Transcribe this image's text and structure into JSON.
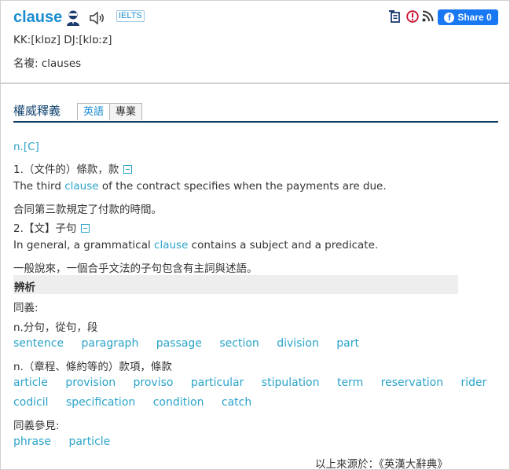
{
  "header": {
    "word": "clause",
    "badge": "IELTS",
    "share_label": "Share 0",
    "pronunciation": "KK:[klɒz] DJ:[klɒːz]",
    "plural": "名複: clauses",
    "icons": [
      "speaker-person-icon",
      "audio-icon",
      "add-to-wordlist-icon",
      "report-error-icon",
      "rss-icon",
      "facebook-icon"
    ],
    "share_color": "#1877f2"
  },
  "tabs": {
    "section_title": "權威釋義",
    "items": [
      {
        "label": "英語",
        "active": true
      },
      {
        "label": "專業",
        "active": false
      }
    ]
  },
  "definitions": {
    "pos": "n.[C]",
    "sense1": {
      "head": "1.（文件的）條款，款",
      "example_before": "The third ",
      "example_key": "clause",
      "example_after": " of the contract specifies when the payments are due.",
      "translation": "合同第三款規定了付款的時間。"
    },
    "sense2": {
      "head": "2.【文】子句",
      "example_before": "In general, a grammatical ",
      "example_key": "clause",
      "example_after": " contains a subject and a predicate.",
      "translation": "一般說來，一個合乎文法的子句包含有主詞與述語。"
    }
  },
  "analysis": {
    "title": "辨析",
    "synonyms_label": "同義:",
    "group1_label": "n.分句，從句，段",
    "group1_words": [
      "sentence",
      "paragraph",
      "passage",
      "section",
      "division",
      "part"
    ],
    "group2_label": "n.（章程、條約等的）款項，條款",
    "group2_words_row1": [
      "article",
      "provision",
      "proviso",
      "particular",
      "stipulation",
      "term",
      "reservation",
      "rider"
    ],
    "group2_words_row2": [
      "codicil",
      "specification",
      "condition",
      "catch"
    ],
    "see_also_label": "同義參見:",
    "see_also_words": [
      "phrase",
      "particle"
    ]
  },
  "source": "以上來源於：《英漢大辭典》",
  "colors": {
    "title_blue": "#1a8dd2",
    "link_teal": "#2aa3c9",
    "tab_underline": "#0e3a66"
  }
}
